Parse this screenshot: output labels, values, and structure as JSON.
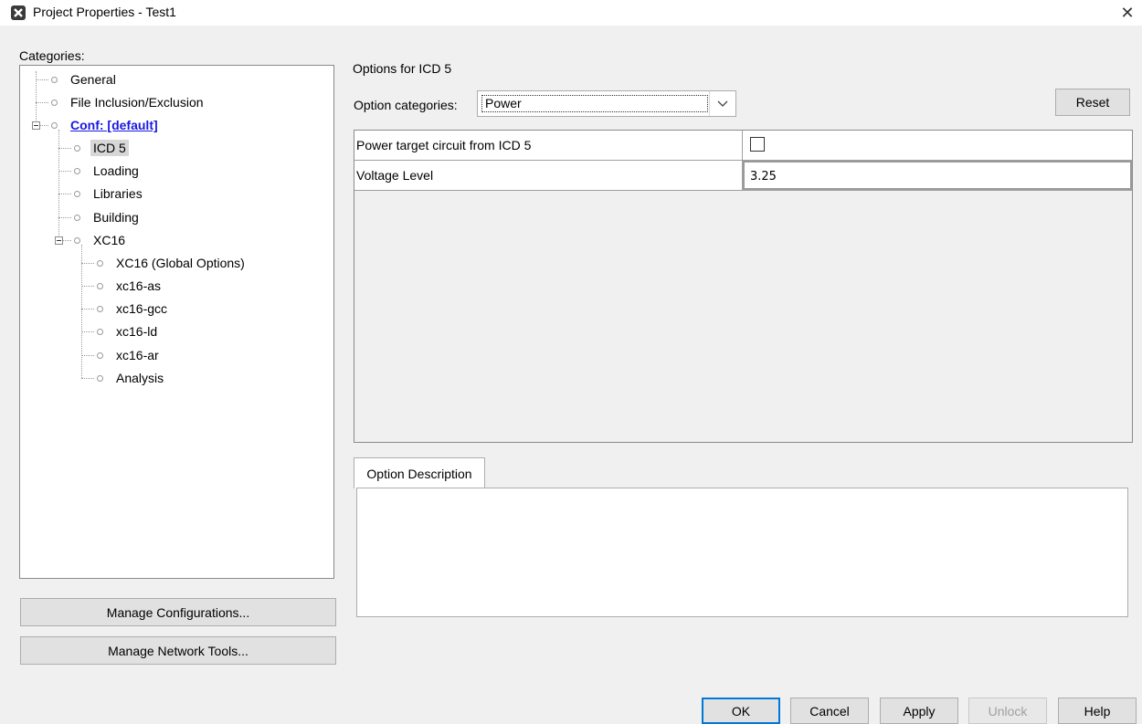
{
  "window": {
    "title": "Project Properties - Test1",
    "close_glyph": "✕"
  },
  "categories": {
    "label": "Categories:",
    "items": [
      {
        "label": "General"
      },
      {
        "label": "File Inclusion/Exclusion"
      },
      {
        "label": "Conf: [default]"
      },
      {
        "label": "ICD 5"
      },
      {
        "label": "Loading"
      },
      {
        "label": "Libraries"
      },
      {
        "label": "Building"
      },
      {
        "label": "XC16"
      },
      {
        "label": "XC16 (Global Options)"
      },
      {
        "label": "xc16-as"
      },
      {
        "label": "xc16-gcc"
      },
      {
        "label": "xc16-ld"
      },
      {
        "label": "xc16-ar"
      },
      {
        "label": "Analysis"
      }
    ]
  },
  "left_buttons": {
    "manage_configurations": "Manage Configurations...",
    "manage_network_tools": "Manage Network Tools..."
  },
  "options": {
    "header": "Options for ICD 5",
    "category_label": "Option categories:",
    "category_value": "Power",
    "reset": "Reset",
    "rows": [
      {
        "name": "Power target circuit from ICD 5",
        "checked": false
      },
      {
        "name": "Voltage Level",
        "value": "3.25"
      }
    ],
    "description_tab": "Option Description",
    "description_text": ""
  },
  "footer_buttons": {
    "ok": "OK",
    "cancel": "Cancel",
    "apply": "Apply",
    "unlock": "Unlock",
    "help": "Help"
  },
  "colors": {
    "link": "#1818e0",
    "default_button_border": "#0078d7",
    "background": "#f0f0f0"
  }
}
